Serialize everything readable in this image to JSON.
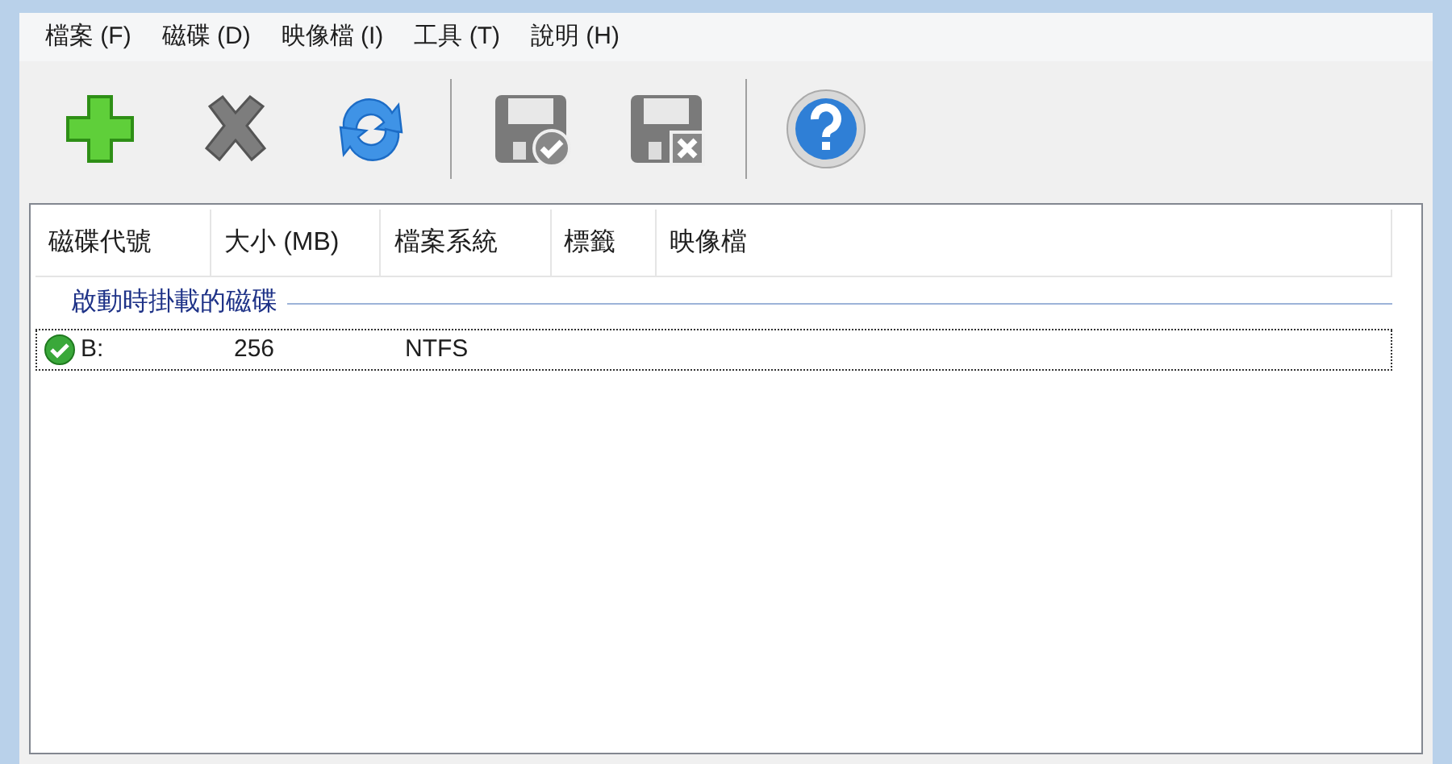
{
  "menu": [
    "檔案 (F)",
    "磁碟 (D)",
    "映像檔 (I)",
    "工具 (T)",
    "說明 (H)"
  ],
  "toolbar": [
    {
      "kind": "plus"
    },
    {
      "kind": "cross"
    },
    {
      "kind": "refresh"
    },
    {
      "kind": "separator"
    },
    {
      "kind": "save-check"
    },
    {
      "kind": "save-cross"
    },
    {
      "kind": "separator"
    },
    {
      "kind": "help"
    }
  ],
  "table": {
    "columns": [
      "磁碟代號",
      "大小 (MB)",
      "檔案系統",
      "標籤",
      "映像檔"
    ],
    "groups": [
      {
        "title": "啟動時掛載的磁碟",
        "rows": [
          {
            "cells": [
              "B:",
              "256",
              "NTFS"
            ],
            "ok": true,
            "focused": true
          }
        ]
      }
    ]
  }
}
